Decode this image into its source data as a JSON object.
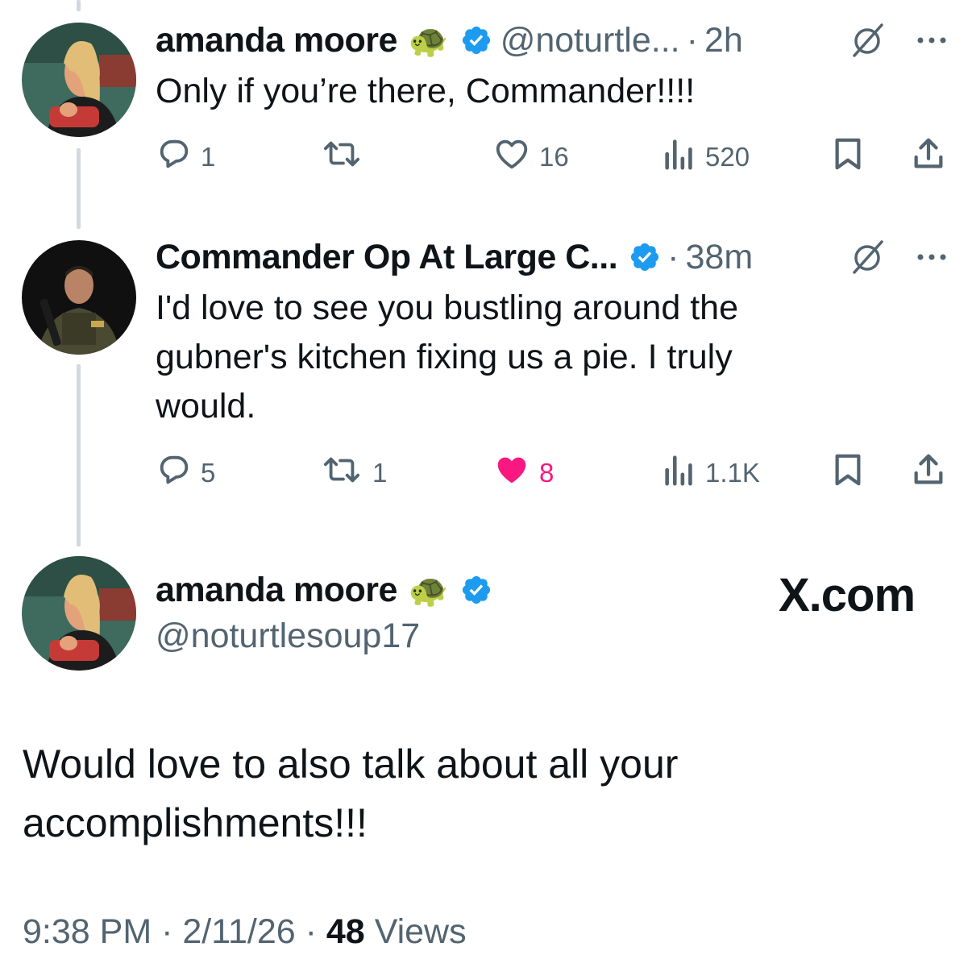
{
  "colors": {
    "verified": "#1d9bf0",
    "like": "#f91880",
    "muted": "#536471",
    "text": "#0f1419",
    "line": "#cfd9de"
  },
  "tweets": [
    {
      "name": "amanda moore",
      "emoji": "🐢",
      "handle": "@noturtle...",
      "sep": "·",
      "time": "2h",
      "text": "Only if you’re there, Commander!!!!",
      "replies": "1",
      "reposts": "",
      "likes": "16",
      "views": "520",
      "liked": false
    },
    {
      "name": "Commander Op At Large C...",
      "emoji": "",
      "handle": "",
      "sep": "·",
      "time": "38m",
      "text": "I'd love to see you bustling around the gubner's kitchen fixing us a pie.  I truly would.",
      "replies": "5",
      "reposts": "1",
      "likes": "8",
      "views": "1.1K",
      "liked": true
    }
  ],
  "main": {
    "name": "amanda moore",
    "emoji": "🐢",
    "handle": "@noturtlesoup17",
    "watermark": "X.com",
    "text": "Would love to also talk about all your accomplishments!!!",
    "time": "9:38 PM",
    "sep1": "·",
    "date": "2/11/26",
    "sep2": "·",
    "views_count": "48",
    "views_label": "Views"
  },
  "icons": [
    "reply-icon",
    "repost-icon",
    "like-icon",
    "views-icon",
    "bookmark-icon",
    "share-icon",
    "grok-icon",
    "more-icon",
    "verified-badge-icon"
  ]
}
